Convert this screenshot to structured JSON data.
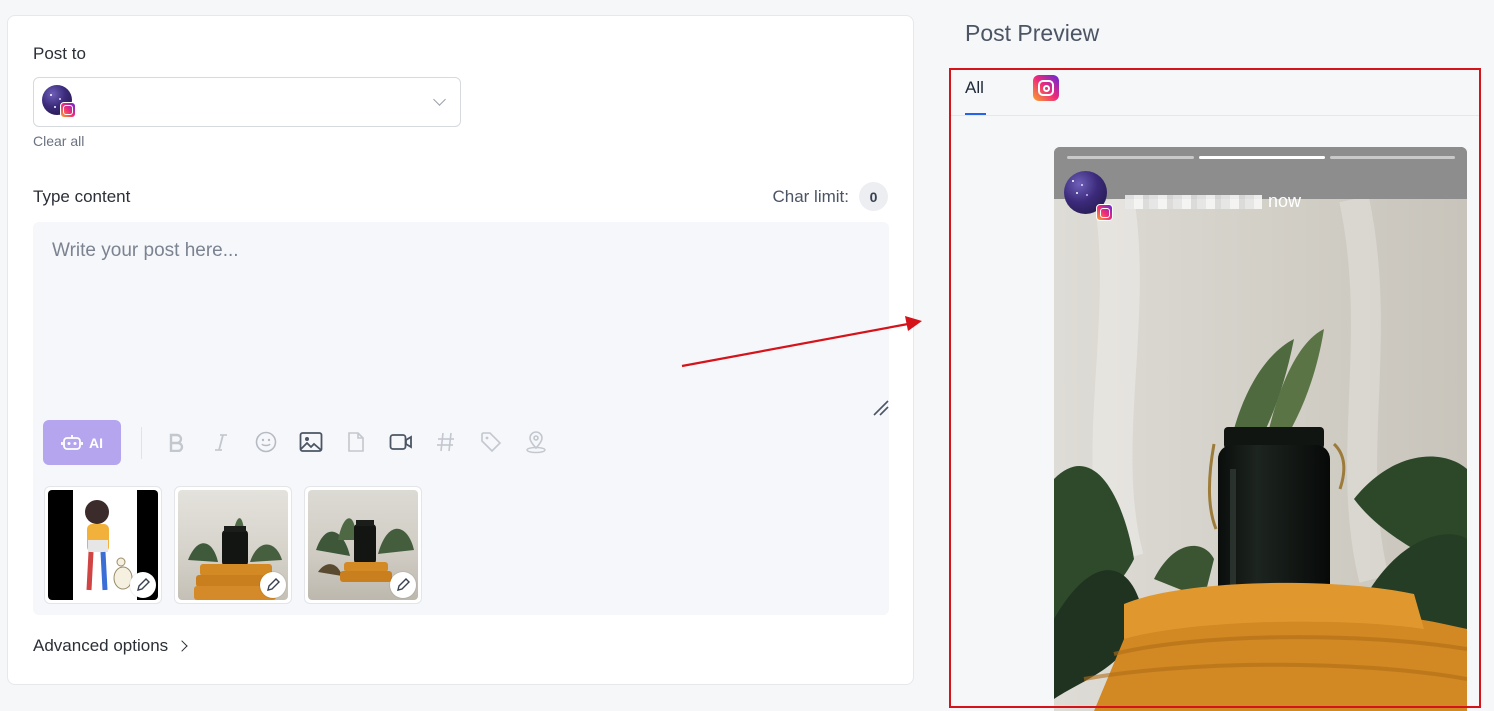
{
  "composer": {
    "post_to_label": "Post to",
    "clear_all_label": "Clear all",
    "type_content_label": "Type content",
    "char_limit_label": "Char limit:",
    "char_limit_value": "0",
    "placeholder": "Write your post here...",
    "ai_label": "AI",
    "toolbar_icons": [
      "bold-icon",
      "italic-icon",
      "emoji-icon",
      "image-icon",
      "document-icon",
      "video-icon",
      "hashtag-icon",
      "tag-icon",
      "location-icon"
    ],
    "advanced_options_label": "Advanced options"
  },
  "preview": {
    "title": "Post Preview",
    "tabs": [
      {
        "label": "All",
        "active": true
      },
      {
        "icon": "instagram-icon"
      }
    ],
    "story_time": "now",
    "story_progress_bars": 3,
    "story_active_bar": 1
  },
  "colors": {
    "accent": "#2563eb",
    "ai_button": "#b5a5ef",
    "annotation_red": "#d4131a"
  }
}
